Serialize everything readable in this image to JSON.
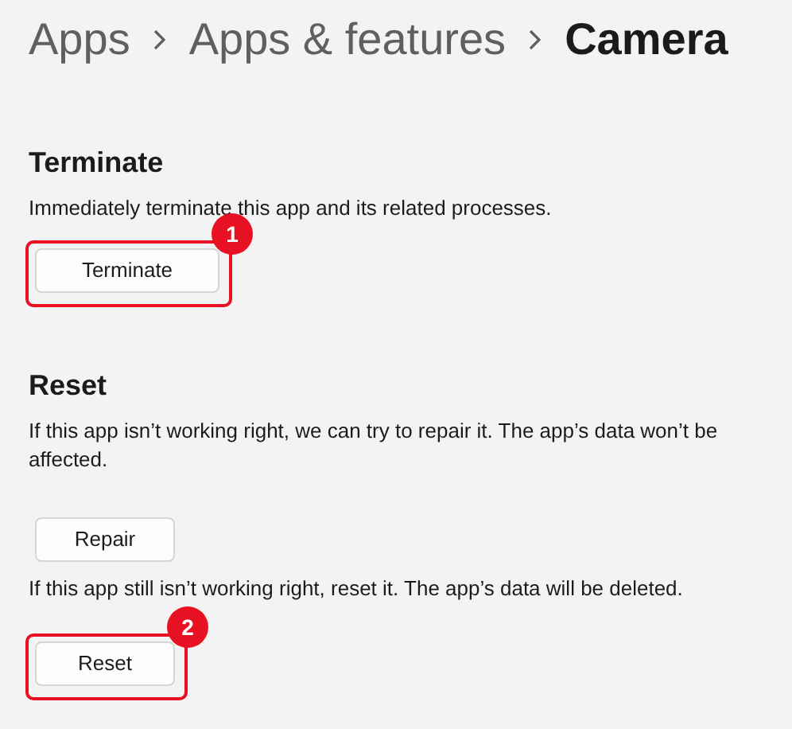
{
  "breadcrumb": [
    {
      "label": "Apps",
      "current": false
    },
    {
      "label": "Apps & features",
      "current": false
    },
    {
      "label": "Camera",
      "current": true
    }
  ],
  "sections": [
    {
      "title": "Terminate",
      "items": [
        {
          "kind": "text",
          "text": "Immediately terminate this app and its related processes."
        },
        {
          "kind": "button",
          "label": "Terminate",
          "callout": "1"
        }
      ]
    },
    {
      "title": "Reset",
      "items": [
        {
          "kind": "text",
          "text": "If this app isn’t working right, we can try to repair it. The app’s data won’t be affected."
        },
        {
          "kind": "button",
          "label": "Repair"
        },
        {
          "kind": "text",
          "text": "If this app still isn’t working right, reset it. The app’s data will be deleted."
        },
        {
          "kind": "button",
          "label": "Reset",
          "callout": "2"
        }
      ]
    }
  ]
}
